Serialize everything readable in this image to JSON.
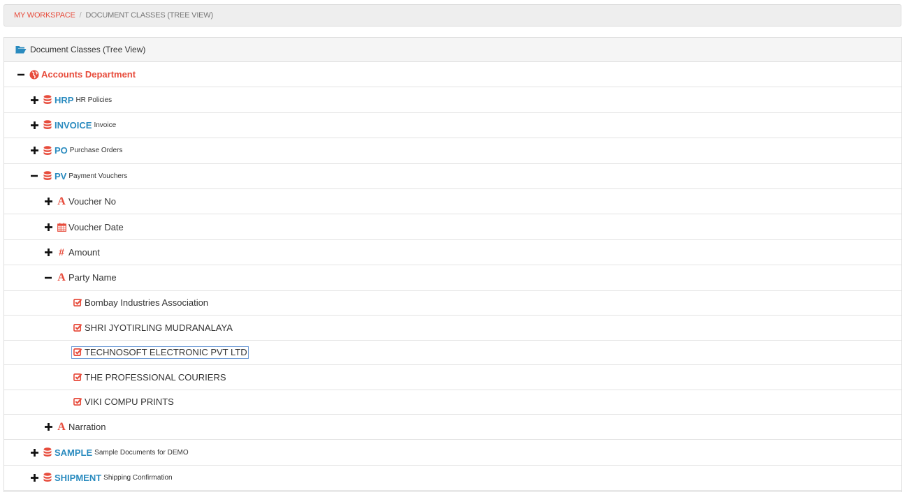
{
  "breadcrumb": {
    "root": "MY WORKSPACE",
    "separator": "/",
    "current": "DOCUMENT CLASSES (TREE VIEW)"
  },
  "panel": {
    "title": "Document Classes (Tree View)",
    "icon": "folder-open-icon"
  },
  "colors": {
    "accent_red": "#e74c3c",
    "class_blue": "#2a8bbf",
    "selection_border": "#6f9bd6"
  },
  "tree": {
    "department": {
      "label": "Accounts Department",
      "icon": "globe-icon",
      "expanded": true
    },
    "classes": [
      {
        "code": "HRP",
        "description": "HR Policies",
        "icon": "database-icon",
        "expanded": false
      },
      {
        "code": "INVOICE",
        "description": "Invoice",
        "icon": "database-icon",
        "expanded": false
      },
      {
        "code": "PO",
        "description": "Purchase Orders",
        "icon": "database-icon",
        "expanded": false
      },
      {
        "code": "PV",
        "description": "Payment Vouchers",
        "icon": "database-icon",
        "expanded": true
      },
      {
        "code": "SAMPLE",
        "description": "Sample Documents for DEMO",
        "icon": "database-icon",
        "expanded": false
      },
      {
        "code": "SHIPMENT",
        "description": "Shipping Confirmation",
        "icon": "database-icon",
        "expanded": false
      }
    ],
    "pv_fields": [
      {
        "label": "Voucher No",
        "icon": "text-field-icon",
        "expanded": false
      },
      {
        "label": "Voucher Date",
        "icon": "calendar-icon",
        "expanded": false
      },
      {
        "label": "Amount",
        "icon": "hash-icon",
        "expanded": false
      },
      {
        "label": "Party Name",
        "icon": "text-field-icon",
        "expanded": true
      },
      {
        "label": "Narration",
        "icon": "text-field-icon",
        "expanded": false
      }
    ],
    "party_values": [
      {
        "label": "Bombay Industries Association",
        "icon": "checkbox-checked-icon",
        "selected": false
      },
      {
        "label": "SHRI JYOTIRLING MUDRANALAYA",
        "icon": "checkbox-checked-icon",
        "selected": false
      },
      {
        "label": "TECHNOSOFT ELECTRONIC PVT LTD",
        "icon": "checkbox-checked-icon",
        "selected": true
      },
      {
        "label": "THE PROFESSIONAL COURIERS",
        "icon": "checkbox-checked-icon",
        "selected": false
      },
      {
        "label": "VIKI COMPU PRINTS",
        "icon": "checkbox-checked-icon",
        "selected": false
      }
    ]
  }
}
